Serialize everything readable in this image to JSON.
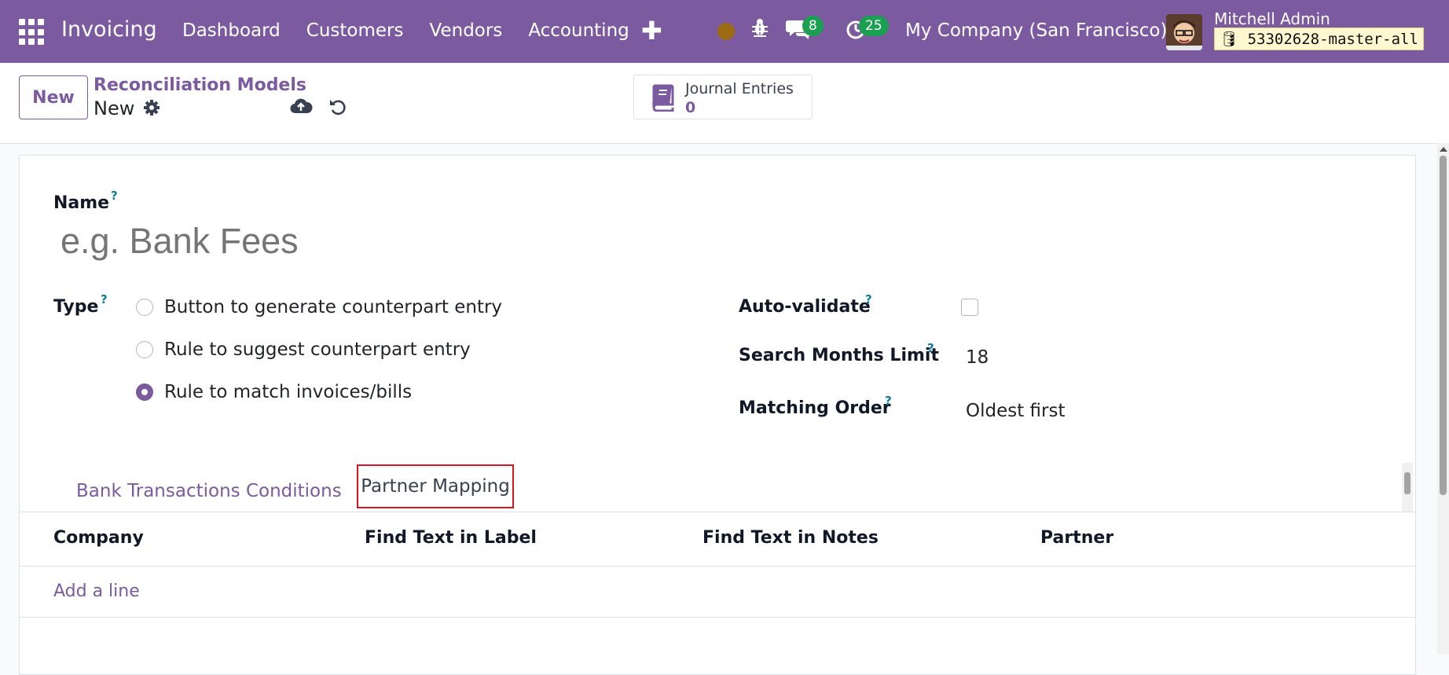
{
  "navbar": {
    "app_name": "Invoicing",
    "menu": [
      "Dashboard",
      "Customers",
      "Vendors",
      "Accounting"
    ],
    "chat_badge": "8",
    "activity_badge": "25",
    "company": "My Company (San Francisco)",
    "user_name": "Mitchell Admin",
    "database": "53302628-master-all",
    "colors": {
      "brand": "#7c5aa0",
      "badge": "#1aa050",
      "status_dot": "#9b6b14"
    }
  },
  "control": {
    "new_button": "New",
    "breadcrumb": "Reconciliation Models",
    "record_name": "New",
    "smart_button": {
      "title": "Journal Entries",
      "value": "0"
    }
  },
  "form": {
    "name_label": "Name",
    "name_placeholder": "e.g. Bank Fees",
    "help_mark": "?",
    "type_label": "Type",
    "type_options": [
      {
        "label": "Button to generate counterpart entry",
        "checked": false
      },
      {
        "label": "Rule to suggest counterpart entry",
        "checked": false
      },
      {
        "label": "Rule to match invoices/bills",
        "checked": true
      }
    ],
    "auto_validate_label": "Auto-validate",
    "auto_validate_checked": false,
    "search_months_label": "Search Months Limit",
    "search_months_value": "18",
    "matching_order_label": "Matching Order",
    "matching_order_value": "Oldest first"
  },
  "tabs": [
    {
      "label": "Bank Transactions Conditions",
      "active": false
    },
    {
      "label": "Partner Mapping",
      "active": true
    }
  ],
  "table": {
    "columns": [
      "Company",
      "Find Text in Label",
      "Find Text in Notes",
      "Partner"
    ],
    "add_line": "Add a line"
  }
}
